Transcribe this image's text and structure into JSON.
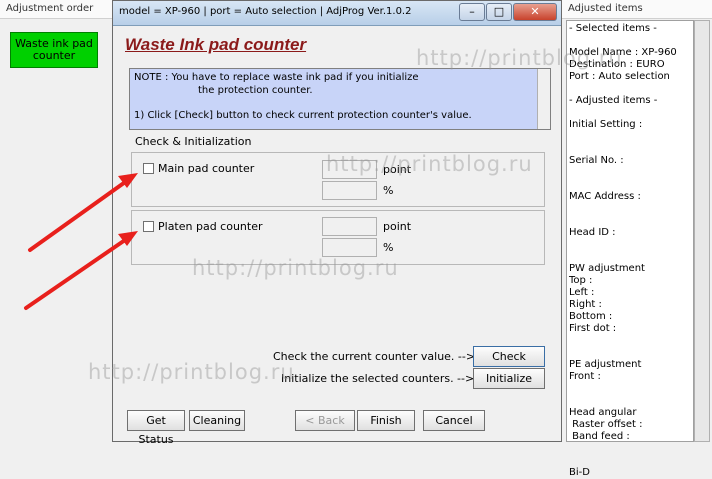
{
  "left_panel": {
    "title": "Adjustment order",
    "waste_button": "Waste ink pad\ncounter"
  },
  "dialog": {
    "title": "model = XP-960 | port = Auto selection | AdjProg Ver.1.0.2",
    "heading": "Waste Ink pad counter",
    "note_line1": "NOTE : You have to replace waste ink pad if you initialize",
    "note_line2": "the protection counter.",
    "note_line3": "1) Click [Check] button to check current protection counter's value.",
    "group_label": "Check & Initialization",
    "main_pad": {
      "label": "Main pad counter",
      "unit_point": "point",
      "unit_percent": "%"
    },
    "platen_pad": {
      "label": "Platen pad counter",
      "unit_point": "point",
      "unit_percent": "%"
    },
    "check_text": "Check the current counter value. -->",
    "check_button": "Check",
    "init_text": "Initialize the selected counters. -->",
    "init_button": "Initialize",
    "footer": {
      "get_status": "Get Status",
      "cleaning": "Cleaning",
      "back": "< Back",
      "finish": "Finish",
      "cancel": "Cancel"
    }
  },
  "right_panel": {
    "title": "Adjusted items",
    "lines": [
      "- Selected items -",
      "",
      "Model Name : XP-960",
      "Destination : EURO",
      "Port : Auto selection",
      "",
      "- Adjusted items -",
      "",
      "Initial Setting :",
      "",
      "",
      "Serial No. :",
      "",
      "",
      "MAC Address :",
      "",
      "",
      "Head ID :",
      "",
      "",
      "PW adjustment",
      "Top :",
      "Left :",
      "Right :",
      "Bottom :",
      "First dot :",
      "",
      "",
      "PE adjustment",
      "Front :",
      "",
      "",
      "Head angular",
      " Raster offset :",
      " Band feed :",
      "",
      "",
      "Bi-D"
    ]
  },
  "watermark": "http://printblog.ru",
  "accent_colors": {
    "arrow": "#e8201c",
    "green_button": "#00d000",
    "note_bg": "#c8d4f8",
    "heading": "#8b1a1a"
  }
}
